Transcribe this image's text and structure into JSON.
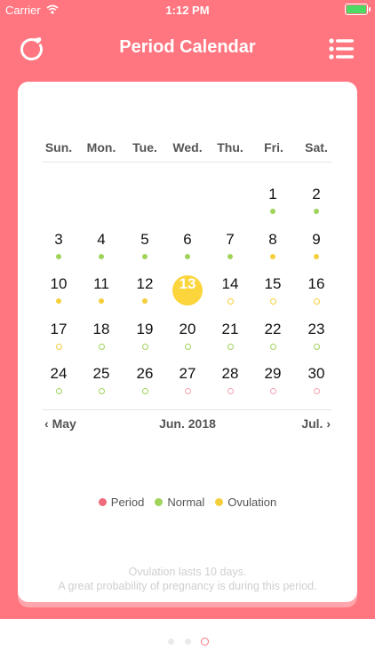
{
  "status": {
    "carrier": "Carrier",
    "time": "1:12 PM"
  },
  "header": {
    "title": "Period Calendar",
    "left_icon": "refresh-heart-icon",
    "right_icon": "list-menu-icon"
  },
  "calendar": {
    "weekdays": [
      "Sun.",
      "Mon.",
      "Tue.",
      "Wed.",
      "Thu.",
      "Fri.",
      "Sat."
    ],
    "rows": [
      [
        "",
        "",
        "",
        "",
        "",
        "1",
        "2"
      ],
      [
        "3",
        "4",
        "5",
        "6",
        "7",
        "8",
        "9"
      ],
      [
        "10",
        "11",
        "12",
        "13",
        "14",
        "15",
        "16"
      ],
      [
        "17",
        "18",
        "19",
        "20",
        "21",
        "22",
        "23"
      ],
      [
        "24",
        "25",
        "26",
        "27",
        "28",
        "29",
        "30"
      ]
    ],
    "today": "13",
    "month_prev": "May",
    "month_current": "Jun. 2018",
    "month_next": "Jul."
  },
  "legend": [
    {
      "label": "Period",
      "color": "#f06b7c"
    },
    {
      "label": "Normal",
      "color": "#9fd35a"
    },
    {
      "label": "Ovulation",
      "color": "#f4cf3b"
    }
  ],
  "note": {
    "line1": "Ovulation lasts 10 days.",
    "line2": "A great probability of pregnancy is during this period."
  },
  "colors": {
    "accent": "#ff7680",
    "period": "#f06b7c",
    "normal": "#9fd35a",
    "ovulation": "#f4cf3b"
  },
  "pager": {
    "count": 3,
    "active": 2
  }
}
